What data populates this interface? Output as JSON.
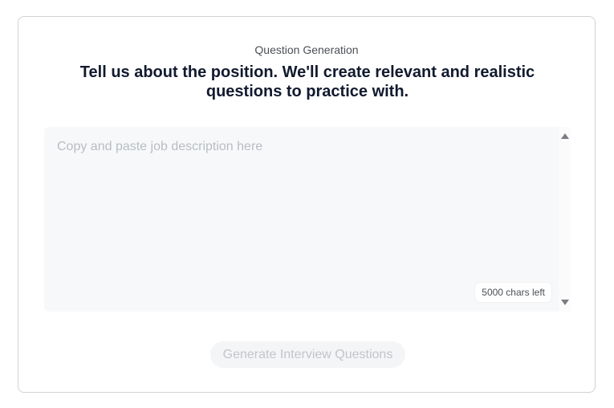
{
  "header": {
    "eyebrow": "Question Generation",
    "headline": "Tell us about the position. We'll create relevant and realistic questions to practice with."
  },
  "job_description": {
    "value": "",
    "placeholder": "Copy and paste job description here",
    "chars_left_label": "5000 chars left"
  },
  "actions": {
    "generate_label": "Generate Interview Questions"
  },
  "colors": {
    "headline": "#111a2e",
    "textarea_bg": "#f7f8fa",
    "button_disabled_bg": "#f4f5f7",
    "button_disabled_text": "#c2c5ca"
  }
}
